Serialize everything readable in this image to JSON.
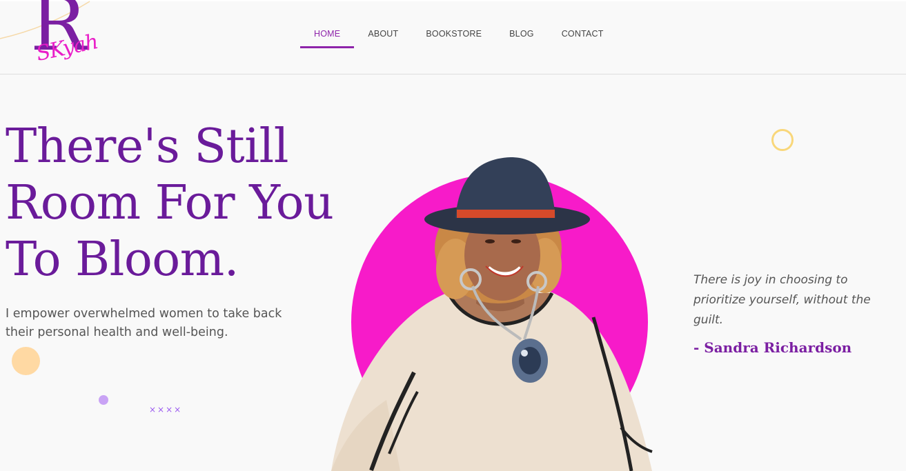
{
  "brand": {
    "logo_letter": "R",
    "logo_script": "SKyah"
  },
  "nav": {
    "items": [
      {
        "label": "HOME",
        "active": true
      },
      {
        "label": "ABOUT",
        "active": false
      },
      {
        "label": "BOOKSTORE",
        "active": false
      },
      {
        "label": "BLOG",
        "active": false
      },
      {
        "label": "CONTACT",
        "active": false
      }
    ]
  },
  "hero": {
    "title_line1": "There's Still",
    "title_line2": "Room For You",
    "title_line3": "To Bloom.",
    "subtitle": "I empower overwhelmed women to take back their personal health and well-being.",
    "decor_crosses": "××××"
  },
  "quote": {
    "text": "There is joy in choosing to prioritize yourself, without the guilt.",
    "author": "- Sandra Richardson"
  },
  "colors": {
    "brand_purple": "#6a1b9a",
    "accent_magenta": "#f71bc9",
    "nav_active": "#8e24aa",
    "peach": "#ffd9a3",
    "yellow_ring": "#f9d77a"
  },
  "icons": {
    "portrait": "woman-in-hat-portrait"
  }
}
